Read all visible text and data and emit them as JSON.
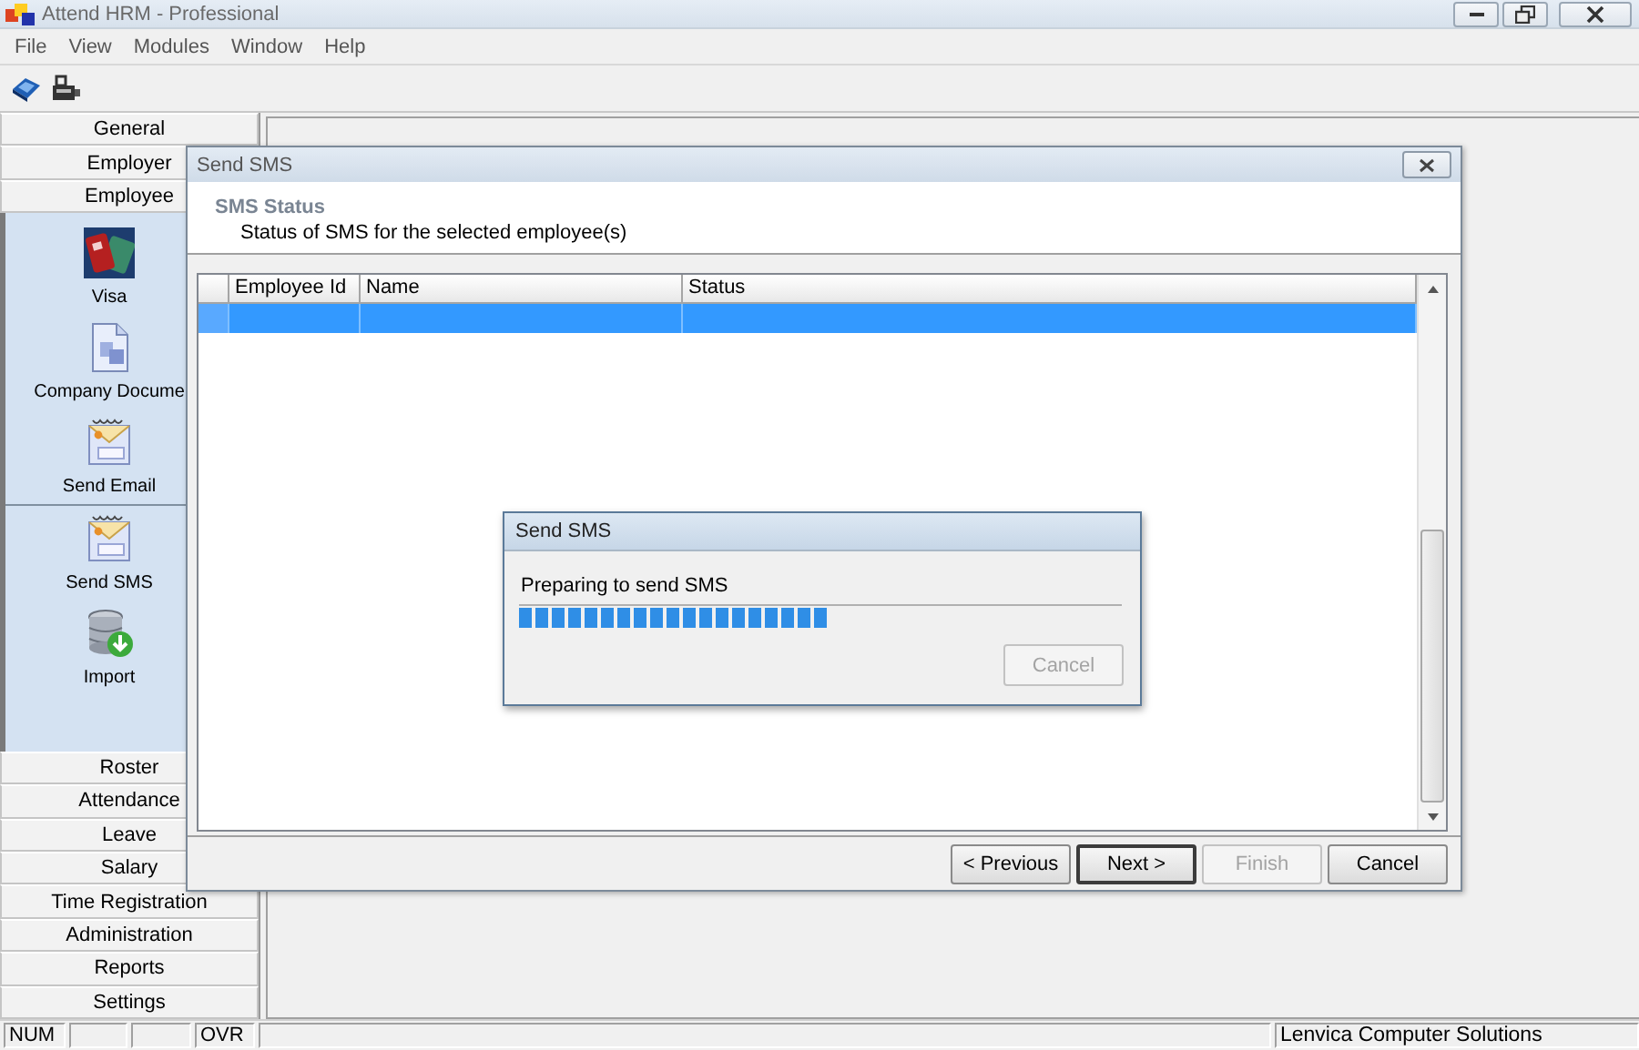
{
  "window": {
    "title": "Attend HRM - Professional"
  },
  "menu": [
    {
      "label": "File"
    },
    {
      "label": "View"
    },
    {
      "label": "Modules"
    },
    {
      "label": "Window"
    },
    {
      "label": "Help"
    }
  ],
  "sidebar": {
    "top_buttons": [
      {
        "label": "General"
      },
      {
        "label": "Employer"
      },
      {
        "label": "Employee"
      }
    ],
    "panel_items": [
      {
        "label": "Visa",
        "kind": "visa"
      },
      {
        "label": "Company Docume",
        "kind": "document"
      },
      {
        "label": "Send Email",
        "kind": "email"
      },
      {
        "label": "Send SMS",
        "kind": "sms"
      },
      {
        "label": "Import",
        "kind": "import"
      }
    ],
    "bottom_buttons": [
      {
        "label": "Roster"
      },
      {
        "label": "Attendance"
      },
      {
        "label": "Leave"
      },
      {
        "label": "Salary"
      },
      {
        "label": "Time Registration"
      },
      {
        "label": "Administration"
      },
      {
        "label": "Reports"
      },
      {
        "label": "Settings"
      }
    ]
  },
  "wizard": {
    "title": "Send SMS",
    "heading": "SMS Status",
    "subheading": "Status of SMS for the selected employee(s)",
    "table": {
      "columns": [
        "Employee Id",
        "Name",
        "Status"
      ],
      "rows": [
        {
          "selected": true
        }
      ]
    },
    "buttons": [
      {
        "label": "< Previous",
        "disabled": false,
        "default": false
      },
      {
        "label": "Next >",
        "disabled": false,
        "default": true
      },
      {
        "label": "Finish",
        "disabled": true,
        "default": false
      },
      {
        "label": "Cancel",
        "disabled": false,
        "default": false
      }
    ]
  },
  "progress_dialog": {
    "title": "Send SMS",
    "message": "Preparing to send SMS",
    "level": 0.51,
    "button": {
      "label": "Cancel",
      "disabled": true
    }
  },
  "status_bar": {
    "num": "NUM",
    "ovr": "OVR",
    "company": "Lenvica Computer Solutions"
  }
}
